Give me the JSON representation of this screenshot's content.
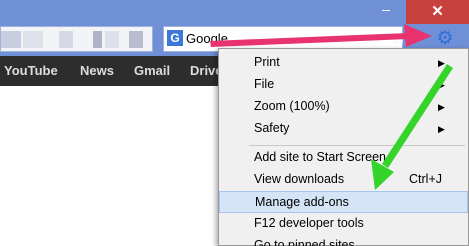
{
  "titlebar": {
    "minimize_glyph": "–",
    "close_glyph": "✕"
  },
  "search": {
    "engine_icon": "G",
    "value": "Google"
  },
  "icons": {
    "home": "home-icon",
    "tools": "gear-icon"
  },
  "bookmarks": [
    "YouTube",
    "News",
    "Gmail",
    "Drive"
  ],
  "menu": {
    "items": [
      {
        "label": "Print",
        "arrow": "▶"
      },
      {
        "label": "File",
        "arrow": "▶"
      },
      {
        "label": "Zoom (100%)",
        "arrow": "▶"
      },
      {
        "label": "Safety",
        "arrow": "▶"
      },
      {
        "label": "Add site to Start Screen"
      },
      {
        "label": "View downloads",
        "shortcut": "Ctrl+J"
      },
      {
        "label": "Manage add-ons",
        "highlighted": true
      },
      {
        "label": "F12 developer tools"
      },
      {
        "label": "Go to pinned sites"
      }
    ]
  },
  "colors": {
    "chrome_blue": "#6f8fd6",
    "close_red": "#c7413f",
    "bookmark_bar": "#2d2d2d",
    "arrow_pink": "#e8336f",
    "arrow_green": "#34d42b",
    "menu_highlight": "#d5e4f6"
  }
}
